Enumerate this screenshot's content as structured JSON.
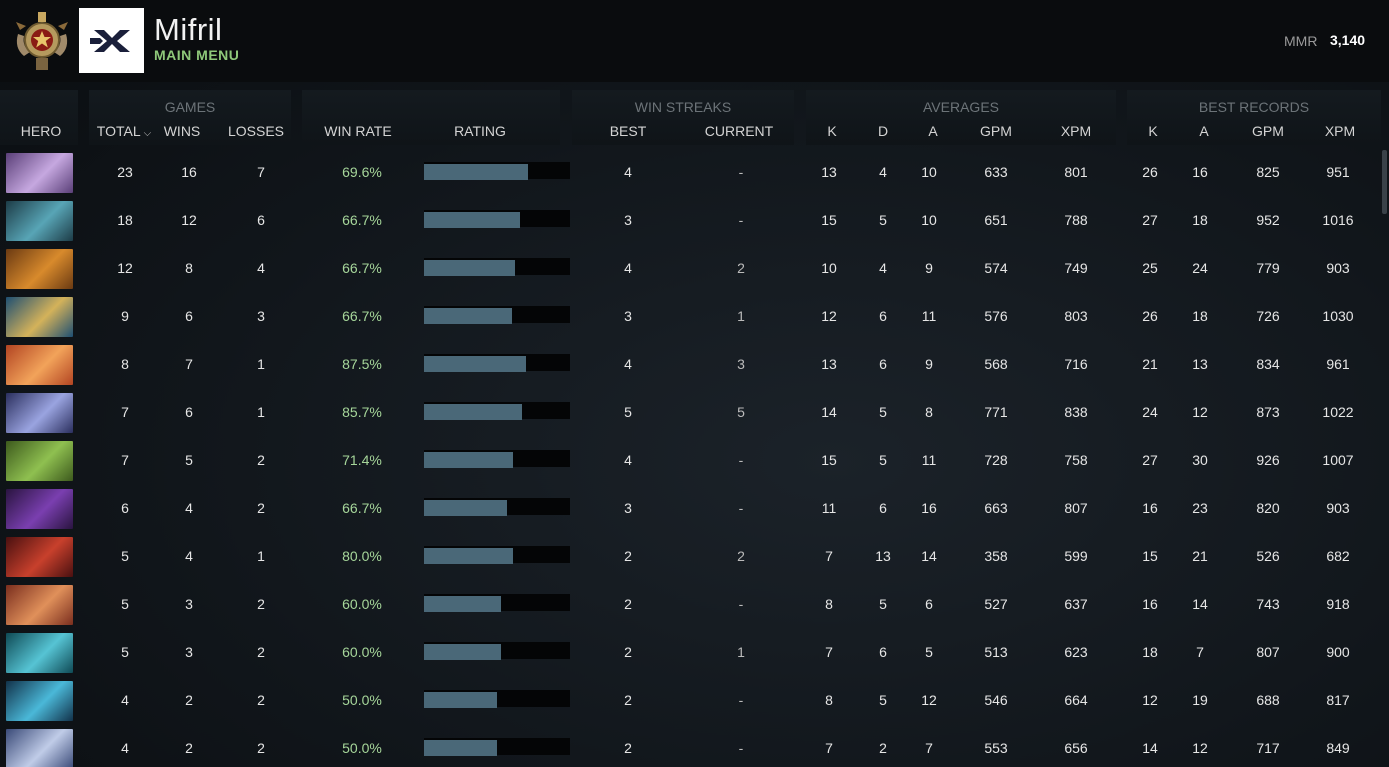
{
  "header": {
    "player_name": "Mifril",
    "subtitle": "MAIN MENU",
    "mmr_label": "MMR",
    "mmr_value": "3,140",
    "logo_text": "XX"
  },
  "groups": {
    "games": "GAMES",
    "win_streaks": "WIN STREAKS",
    "averages": "AVERAGES",
    "best_records": "BEST RECORDS"
  },
  "columns": {
    "hero": "HERO",
    "total": "TOTAL",
    "wins": "WINS",
    "losses": "LOSSES",
    "win_rate": "WIN RATE",
    "rating": "RATING",
    "best": "BEST",
    "current": "CURRENT",
    "avg_k": "K",
    "avg_d": "D",
    "avg_a": "A",
    "avg_gpm": "GPM",
    "avg_xpm": "XPM",
    "rec_k": "K",
    "rec_a": "A",
    "rec_gpm": "GPM",
    "rec_xpm": "XPM"
  },
  "rows": [
    {
      "hero_icon": "hero-purple-icon",
      "c1": "#5a3f78",
      "c2": "#c6a8e0",
      "total": "23",
      "wins": "16",
      "losses": "7",
      "wr": "69.6%",
      "rating": 0.71,
      "best": "4",
      "current": "-",
      "k": "13",
      "d": "4",
      "a": "10",
      "gpm": "633",
      "xpm": "801",
      "rk": "26",
      "ra": "16",
      "rgpm": "825",
      "rxpm": "951"
    },
    {
      "hero_icon": "hero-teal-icon",
      "c1": "#1d3c47",
      "c2": "#58a5b6",
      "total": "18",
      "wins": "12",
      "losses": "6",
      "wr": "66.7%",
      "rating": 0.66,
      "best": "3",
      "current": "-",
      "k": "15",
      "d": "5",
      "a": "10",
      "gpm": "651",
      "xpm": "788",
      "rk": "27",
      "ra": "18",
      "rgpm": "952",
      "rxpm": "1016"
    },
    {
      "hero_icon": "hero-orange-icon",
      "c1": "#6b3a12",
      "c2": "#d88a2c",
      "total": "12",
      "wins": "8",
      "losses": "4",
      "wr": "66.7%",
      "rating": 0.62,
      "best": "4",
      "current": "2",
      "k": "10",
      "d": "4",
      "a": "9",
      "gpm": "574",
      "xpm": "749",
      "rk": "25",
      "ra": "24",
      "rgpm": "779",
      "rxpm": "903"
    },
    {
      "hero_icon": "hero-blue-gold-icon",
      "c1": "#1e4f72",
      "c2": "#d4b25a",
      "total": "9",
      "wins": "6",
      "losses": "3",
      "wr": "66.7%",
      "rating": 0.6,
      "best": "3",
      "current": "1",
      "k": "12",
      "d": "6",
      "a": "11",
      "gpm": "576",
      "xpm": "803",
      "rk": "26",
      "ra": "18",
      "rgpm": "726",
      "rxpm": "1030"
    },
    {
      "hero_icon": "hero-red-hair-icon",
      "c1": "#b24422",
      "c2": "#f2a35a",
      "total": "8",
      "wins": "7",
      "losses": "1",
      "wr": "87.5%",
      "rating": 0.7,
      "best": "4",
      "current": "3",
      "k": "13",
      "d": "6",
      "a": "9",
      "gpm": "568",
      "xpm": "716",
      "rk": "21",
      "ra": "13",
      "rgpm": "834",
      "rxpm": "961"
    },
    {
      "hero_icon": "hero-moon-icon",
      "c1": "#2b2f5e",
      "c2": "#9aa4e0",
      "total": "7",
      "wins": "6",
      "losses": "1",
      "wr": "85.7%",
      "rating": 0.67,
      "best": "5",
      "current": "5",
      "k": "14",
      "d": "5",
      "a": "8",
      "gpm": "771",
      "xpm": "838",
      "rk": "24",
      "ra": "12",
      "rgpm": "873",
      "rxpm": "1022"
    },
    {
      "hero_icon": "hero-green-icon",
      "c1": "#3d5a1d",
      "c2": "#8fc050",
      "total": "7",
      "wins": "5",
      "losses": "2",
      "wr": "71.4%",
      "rating": 0.61,
      "best": "4",
      "current": "-",
      "k": "15",
      "d": "5",
      "a": "11",
      "gpm": "728",
      "xpm": "758",
      "rk": "27",
      "ra": "30",
      "rgpm": "926",
      "rxpm": "1007"
    },
    {
      "hero_icon": "hero-void-icon",
      "c1": "#2a1440",
      "c2": "#7a3fb0",
      "total": "6",
      "wins": "4",
      "losses": "2",
      "wr": "66.7%",
      "rating": 0.57,
      "best": "3",
      "current": "-",
      "k": "11",
      "d": "6",
      "a": "16",
      "gpm": "663",
      "xpm": "807",
      "rk": "16",
      "ra": "23",
      "rgpm": "820",
      "rxpm": "903"
    },
    {
      "hero_icon": "hero-red-demon-icon",
      "c1": "#4a1010",
      "c2": "#c8402c",
      "total": "5",
      "wins": "4",
      "losses": "1",
      "wr": "80.0%",
      "rating": 0.61,
      "best": "2",
      "current": "2",
      "k": "7",
      "d": "13",
      "a": "14",
      "gpm": "358",
      "xpm": "599",
      "rk": "15",
      "ra": "21",
      "rgpm": "526",
      "rxpm": "682"
    },
    {
      "hero_icon": "hero-brute-icon",
      "c1": "#7a2e1e",
      "c2": "#e0905a",
      "total": "5",
      "wins": "3",
      "losses": "2",
      "wr": "60.0%",
      "rating": 0.53,
      "best": "2",
      "current": "-",
      "k": "8",
      "d": "5",
      "a": "6",
      "gpm": "527",
      "xpm": "637",
      "rk": "16",
      "ra": "14",
      "rgpm": "743",
      "rxpm": "918"
    },
    {
      "hero_icon": "hero-water-icon",
      "c1": "#0f4a55",
      "c2": "#56c4d4",
      "total": "5",
      "wins": "3",
      "losses": "2",
      "wr": "60.0%",
      "rating": 0.53,
      "best": "2",
      "current": "1",
      "k": "7",
      "d": "6",
      "a": "5",
      "gpm": "513",
      "xpm": "623",
      "rk": "18",
      "ra": "7",
      "rgpm": "807",
      "rxpm": "900"
    },
    {
      "hero_icon": "hero-cyan-icon",
      "c1": "#12324a",
      "c2": "#4ab8d8",
      "total": "4",
      "wins": "2",
      "losses": "2",
      "wr": "50.0%",
      "rating": 0.5,
      "best": "2",
      "current": "-",
      "k": "8",
      "d": "5",
      "a": "12",
      "gpm": "546",
      "xpm": "664",
      "rk": "12",
      "ra": "19",
      "rgpm": "688",
      "rxpm": "817"
    },
    {
      "hero_icon": "hero-archer-icon",
      "c1": "#3a4a78",
      "c2": "#c0cce8",
      "total": "4",
      "wins": "2",
      "losses": "2",
      "wr": "50.0%",
      "rating": 0.5,
      "best": "2",
      "current": "-",
      "k": "7",
      "d": "2",
      "a": "7",
      "gpm": "553",
      "xpm": "656",
      "rk": "14",
      "ra": "12",
      "rgpm": "717",
      "rxpm": "849"
    }
  ]
}
